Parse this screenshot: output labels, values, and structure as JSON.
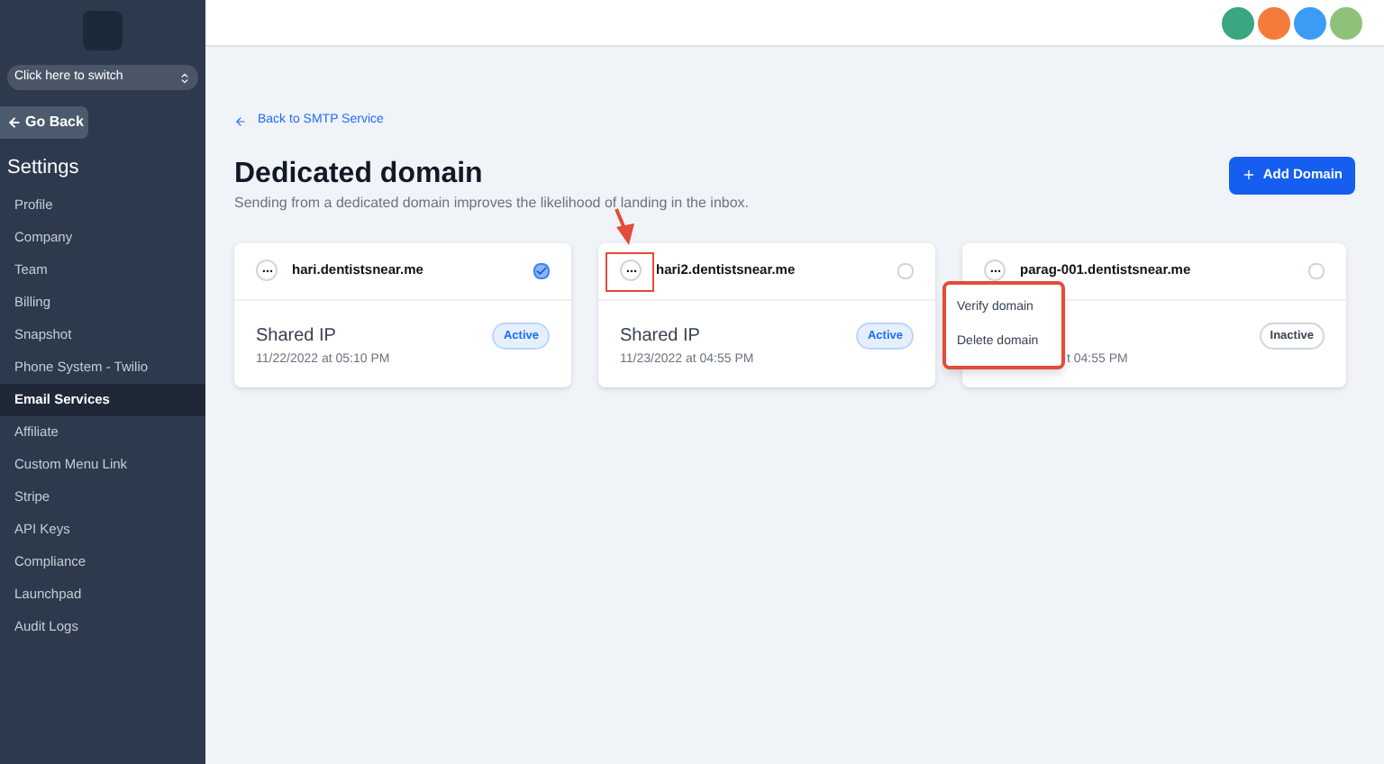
{
  "sidebar": {
    "switcher": "Click here to switch",
    "back_button": "Go Back",
    "heading": "Settings",
    "items": [
      {
        "label": "Profile",
        "selected": false
      },
      {
        "label": "Company",
        "selected": false
      },
      {
        "label": "Team",
        "selected": false
      },
      {
        "label": "Billing",
        "selected": false
      },
      {
        "label": "Snapshot",
        "selected": false
      },
      {
        "label": "Phone System - Twilio",
        "selected": false
      },
      {
        "label": "Email Services",
        "selected": true
      },
      {
        "label": "Affiliate",
        "selected": false
      },
      {
        "label": "Custom Menu Link",
        "selected": false
      },
      {
        "label": "Stripe",
        "selected": false
      },
      {
        "label": "API Keys",
        "selected": false
      },
      {
        "label": "Compliance",
        "selected": false
      },
      {
        "label": "Launchpad",
        "selected": false
      },
      {
        "label": "Audit Logs",
        "selected": false
      }
    ]
  },
  "top_bar": {
    "avatars": [
      {
        "color": "#3aa57f"
      },
      {
        "color": "#f47b3a"
      },
      {
        "color": "#3b9cf4"
      },
      {
        "color": "#8ec27a"
      }
    ]
  },
  "back_link": "Back to SMTP Service",
  "title": "Dedicated domain",
  "subtitle": "Sending from a dedicated domain improves the likelihood of landing in the inbox.",
  "add_button": "Add Domain",
  "domains": [
    {
      "name": "hari.dentistsnear.me",
      "checked": true,
      "ip": "Shared IP",
      "date": "11/22/2022 at 05:10 PM",
      "status": "Active",
      "active": true
    },
    {
      "name": "hari2.dentistsnear.me",
      "checked": false,
      "ip": "Shared IP",
      "date": "11/23/2022 at 04:55 PM",
      "status": "Active",
      "active": true
    },
    {
      "name": "parag-001.dentistsnear.me",
      "checked": false,
      "date": "t 04:55 PM",
      "status": "Inactive",
      "active": false
    }
  ],
  "menu": {
    "items": [
      "Verify domain",
      "Delete domain"
    ]
  }
}
